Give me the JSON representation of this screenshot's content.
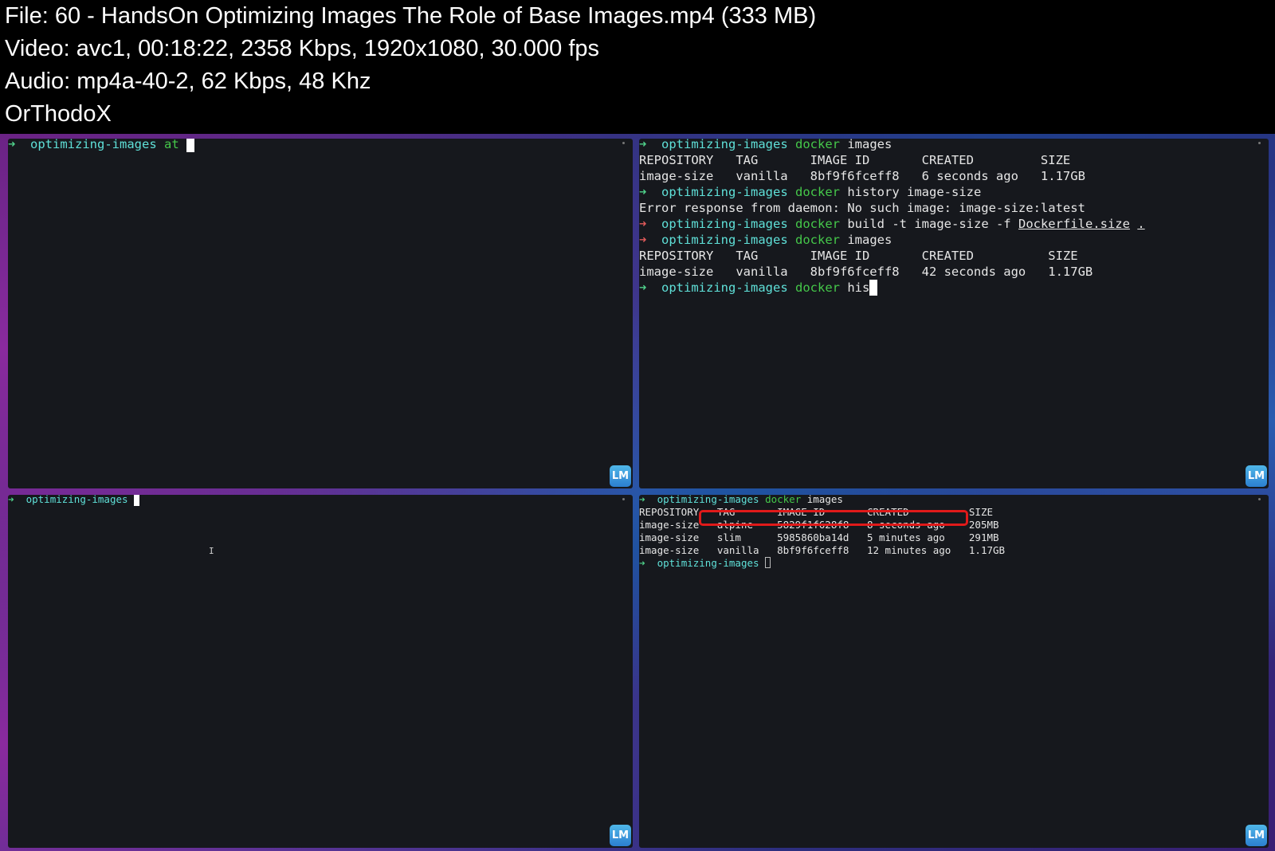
{
  "header": {
    "file_line": "File: 60 - HandsOn Optimizing Images The Role of Base Images.mp4 (333 MB)",
    "video_line": "Video: avc1, 00:18:22, 2358 Kbps, 1920x1080, 30.000 fps",
    "audio_line": "Audio: mp4a-40-2, 62 Kbps, 48 Khz",
    "uploader_line": "OrThodoX"
  },
  "colors": {
    "terminal_bg": "#16181d",
    "prompt_arrow": "#4fd08a",
    "prompt_dir": "#5fe0d8",
    "command": "#45c84a",
    "highlight_box": "#e01a1a"
  },
  "icons": {
    "prompt": "arrow-right-icon",
    "watermark": "lm-logo-icon"
  },
  "badge_text": "LM",
  "terminals": {
    "top_left": {
      "prompt_arrow": "➜",
      "prompt_dir": "optimizing-images",
      "typed": "at"
    },
    "top_right": {
      "lines": {
        "l1_dir": "optimizing-images",
        "l1_cmd": "docker",
        "l1_args": "images",
        "l2": "REPOSITORY   TAG       IMAGE ID       CREATED         SIZE",
        "l3": "image-size   vanilla   8bf9f6fceff8   6 seconds ago   1.17GB",
        "l4_dir": "optimizing-images",
        "l4_cmd": "docker",
        "l4_args": "history image-size",
        "l5": "Error response from daemon: No such image: image-size:latest",
        "l6_dir": "optimizing-images",
        "l6_cmd": "docker",
        "l6_args": "build -t image-size -f ",
        "l6_file": "Dockerfile.size",
        "l6_ctx": ".",
        "l7_dir": "optimizing-images",
        "l7_cmd": "docker",
        "l7_args": "images",
        "l8": "REPOSITORY   TAG       IMAGE ID       CREATED          SIZE",
        "l9": "image-size   vanilla   8bf9f6fceff8   42 seconds ago   1.17GB",
        "l10_dir": "optimizing-images",
        "l10_cmd": "docker",
        "l10_args": "his"
      }
    },
    "bottom_left": {
      "prompt_dir": "optimizing-images"
    },
    "bottom_right": {
      "l1_dir": "optimizing-images",
      "l1_cmd": "docker",
      "l1_args": "images",
      "header": "REPOSITORY   TAG       IMAGE ID       CREATED          SIZE",
      "rows": [
        "image-size   alpine    5829f1f628f8   8 seconds ago    205MB",
        "image-size   slim      5985860ba14d   5 minutes ago    291MB",
        "image-size   vanilla   8bf9f6fceff8   12 minutes ago   1.17GB"
      ],
      "last_dir": "optimizing-images"
    }
  }
}
